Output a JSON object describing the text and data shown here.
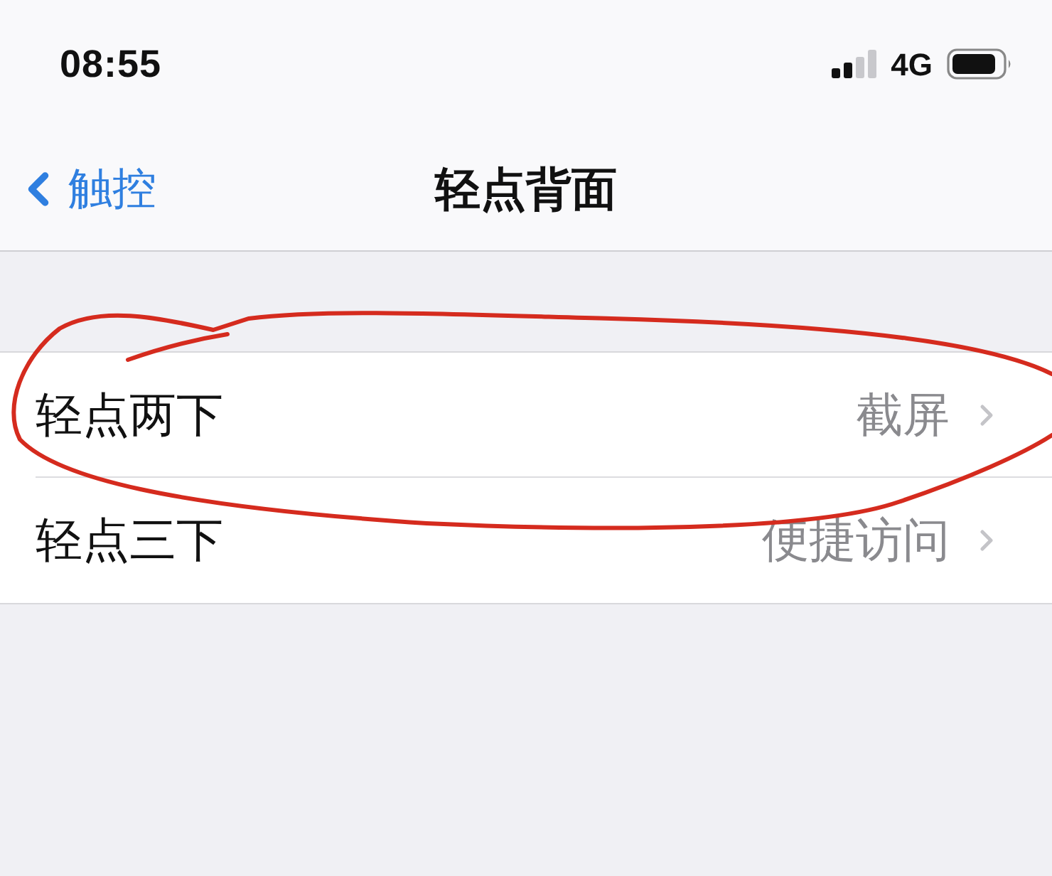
{
  "status_bar": {
    "time": "08:55",
    "network": "4G"
  },
  "nav_bar": {
    "back_label": "触控",
    "title": "轻点背面"
  },
  "rows": [
    {
      "label": "轻点两下",
      "value": "截屏",
      "circled": true
    },
    {
      "label": "轻点三下",
      "value": "便捷访问",
      "circled": false
    }
  ]
}
